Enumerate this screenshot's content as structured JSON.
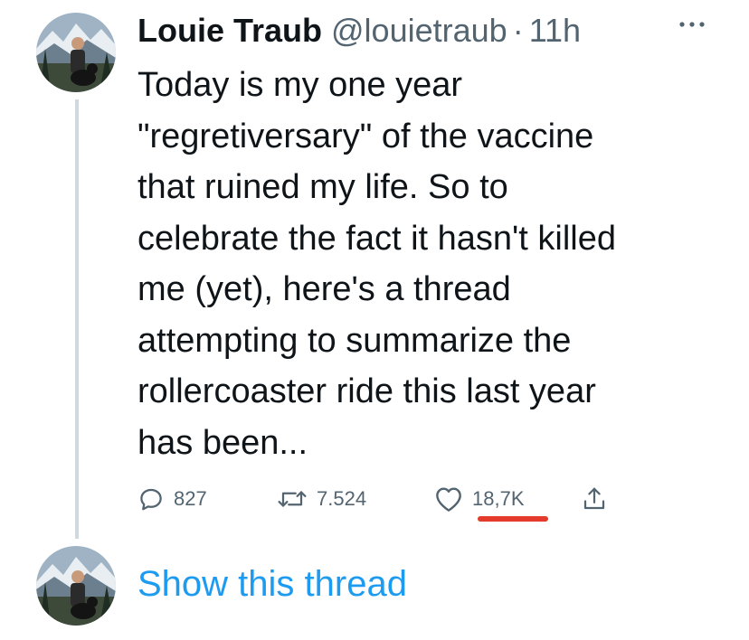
{
  "tweet": {
    "author_name": "Louie Traub",
    "handle": "@louietraub",
    "separator": "·",
    "time": "11h",
    "more_icon": "more-horizontal-icon",
    "text_lines": [
      "Today is my one year",
      "\"regretiversary\" of the vaccine",
      "that ruined my life. So to",
      "celebrate the fact it hasn't killed",
      "me (yet), here's a thread",
      "attempting to summarize the",
      "rollercoaster ride this last year",
      "has been..."
    ]
  },
  "actions": {
    "reply": {
      "icon": "reply-icon",
      "count": "827"
    },
    "retweet": {
      "icon": "retweet-icon",
      "count": "7.524"
    },
    "like": {
      "icon": "heart-icon",
      "count": "18,7K",
      "highlight_color": "#e53b2c"
    },
    "share": {
      "icon": "share-icon"
    }
  },
  "show_thread_label": "Show this thread",
  "colors": {
    "text": "#0f1419",
    "secondary": "#536471",
    "link": "#1d9bf0",
    "thread_line": "#cfd9de"
  }
}
